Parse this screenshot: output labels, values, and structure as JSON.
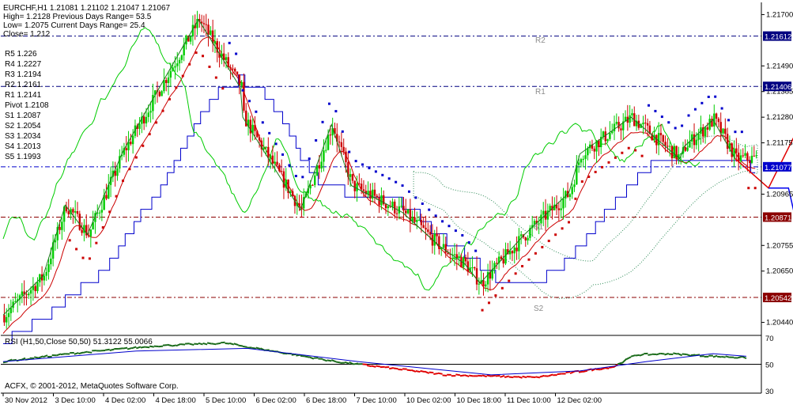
{
  "header": {
    "symbol_line": "EURCHF,H1  1.21081 1.21102 1.21047 1.21067",
    "high_line": "High= 1.2128    Previous Days Range= 53.5",
    "low_line": "Low= 1.2075    Current Days Range= 25.4",
    "close_line": "Close= 1.212"
  },
  "pivots": [
    {
      "label": "R5 1.226"
    },
    {
      "label": "R4 1.2227"
    },
    {
      "label": "R3 1.2194"
    },
    {
      "label": "R2 1.2161"
    },
    {
      "label": "R1 1.2141"
    },
    {
      "label": "Pivot 1.2108"
    },
    {
      "label": "S1 1.2087"
    },
    {
      "label": "S2 1.2054"
    },
    {
      "label": "S3 1.2034"
    },
    {
      "label": "S4 1.2013"
    },
    {
      "label": "S5 1.1993"
    }
  ],
  "levels": [
    {
      "name": "R2",
      "price": 1.21612,
      "price_label": "1.21612",
      "color": "#000080"
    },
    {
      "name": "R1",
      "price": 1.21406,
      "price_label": "1.21406",
      "color": "#000080"
    },
    {
      "name": "Pivot",
      "price": 1.21077,
      "price_label": "1.21077",
      "color": "#0000cc"
    },
    {
      "name": "S1",
      "price": 1.20871,
      "price_label": "1.20871",
      "color": "#8b0000"
    },
    {
      "name": "S2",
      "price": 1.20542,
      "price_label": "1.20542",
      "color": "#8b0000"
    }
  ],
  "level_labels": {
    "r2": "R2",
    "r1": "R1",
    "s1": "S1",
    "s2": "S2"
  },
  "rsi_label": "RSI (H1,50,Close 50,50) 51.3122 55.0066",
  "copyright": "ACFX, © 2001-2012, MetaQuotes Software Corp.",
  "colors": {
    "bull": "#00cc00",
    "bear": "#cc0000",
    "blue": "#0000cc",
    "red_line": "#cc0000",
    "green_line": "#00cc00",
    "cloud": "#2e8b57"
  },
  "chart_data": {
    "type": "line",
    "title": "EURCHF,H1",
    "y_axis": {
      "min": 1.2039,
      "max": 1.2175,
      "ticks": [
        {
          "v": 1.217,
          "label": "1.21700"
        },
        {
          "v": 1.2149,
          "label": "1.21490"
        },
        {
          "v": 1.21385,
          "label": "1.21385"
        },
        {
          "v": 1.2128,
          "label": "1.21280"
        },
        {
          "v": 1.21175,
          "label": "1.21175"
        },
        {
          "v": 1.20965,
          "label": "1.20965"
        },
        {
          "v": 1.20755,
          "label": "1.20755"
        },
        {
          "v": 1.2065,
          "label": "1.20650"
        },
        {
          "v": 1.2044,
          "label": "1.20440"
        }
      ]
    },
    "x_axis": {
      "ticks": [
        "30 Nov 2012",
        "3 Dec 10:00",
        "4 Dec 02:00",
        "4 Dec 18:00",
        "5 Dec 10:00",
        "6 Dec 02:00",
        "6 Dec 18:00",
        "7 Dec 10:00",
        "10 Dec 02:00",
        "10 Dec 18:00",
        "11 Dec 10:00",
        "12 Dec 02:00"
      ]
    },
    "zigzag": [
      {
        "i": 0,
        "p": 1.2047
      },
      {
        "i": 18,
        "p": 1.2063
      },
      {
        "i": 28,
        "p": 1.2092
      },
      {
        "i": 38,
        "p": 1.208
      },
      {
        "i": 54,
        "p": 1.2114
      },
      {
        "i": 88,
        "p": 1.2168
      },
      {
        "i": 107,
        "p": 1.214
      },
      {
        "i": 108,
        "p": 1.2128
      },
      {
        "i": 134,
        "p": 1.209
      },
      {
        "i": 148,
        "p": 1.2125
      },
      {
        "i": 157,
        "p": 1.21
      },
      {
        "i": 180,
        "p": 1.2089
      },
      {
        "i": 197,
        "p": 1.2075
      },
      {
        "i": 208,
        "p": 1.2068
      },
      {
        "i": 215,
        "p": 1.206
      },
      {
        "i": 235,
        "p": 1.208
      },
      {
        "i": 255,
        "p": 1.2097
      },
      {
        "i": 260,
        "p": 1.2113
      },
      {
        "i": 283,
        "p": 1.2128
      },
      {
        "i": 305,
        "p": 1.2111
      },
      {
        "i": 307,
        "p": 1.2116
      },
      {
        "i": 320,
        "p": 1.2127
      },
      {
        "i": 330,
        "p": 1.2111
      }
    ],
    "forecast_up": [
      {
        "i": 330,
        "p": 1.2111
      },
      {
        "i": 345,
        "p": 1.2099
      },
      {
        "i": 368,
        "p": 1.2141
      }
    ],
    "forecast_down": [
      {
        "i": 345,
        "p": 1.2099
      },
      {
        "i": 354,
        "p": 1.2099
      },
      {
        "i": 363,
        "p": 1.2063
      },
      {
        "i": 372,
        "p": 1.2069
      }
    ],
    "rsi": {
      "range": [
        30,
        70
      ],
      "ticks": [
        {
          "v": 70,
          "label": "70"
        },
        {
          "v": 50,
          "label": "50"
        },
        {
          "v": 30,
          "label": "30"
        }
      ],
      "rsi_points": [
        {
          "i": 0,
          "v": 52
        },
        {
          "i": 30,
          "v": 58
        },
        {
          "i": 70,
          "v": 64
        },
        {
          "i": 100,
          "v": 66
        },
        {
          "i": 150,
          "v": 52
        },
        {
          "i": 200,
          "v": 42
        },
        {
          "i": 240,
          "v": 40
        },
        {
          "i": 275,
          "v": 48
        },
        {
          "i": 285,
          "v": 57
        },
        {
          "i": 300,
          "v": 58
        },
        {
          "i": 320,
          "v": 56
        },
        {
          "i": 335,
          "v": 55
        }
      ],
      "signal_points": [
        {
          "i": 0,
          "v": 52
        },
        {
          "i": 60,
          "v": 60
        },
        {
          "i": 110,
          "v": 62
        },
        {
          "i": 160,
          "v": 52
        },
        {
          "i": 220,
          "v": 42
        },
        {
          "i": 260,
          "v": 45
        },
        {
          "i": 290,
          "v": 52
        },
        {
          "i": 320,
          "v": 58
        },
        {
          "i": 335,
          "v": 56
        }
      ]
    }
  }
}
